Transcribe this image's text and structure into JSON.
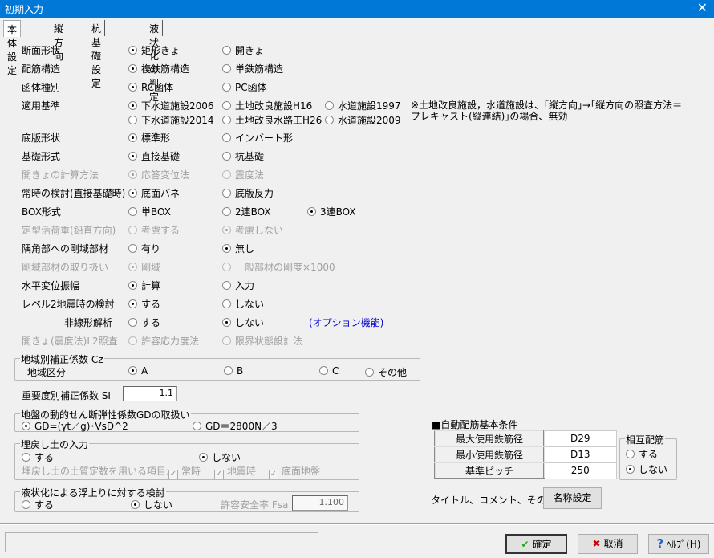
{
  "window": {
    "title": "初期入力",
    "close_label": "✕"
  },
  "tabs": [
    {
      "label": "本体設定",
      "active": true
    },
    {
      "label": "縦方向"
    },
    {
      "label": "杭基礎設定"
    },
    {
      "label": "液状化の判定"
    }
  ],
  "rows": [
    {
      "label": "断面形状",
      "options": [
        {
          "text": "矩形きょ",
          "checked": true
        },
        {
          "text": "開きょ"
        }
      ]
    },
    {
      "label": "配筋構造",
      "options": [
        {
          "text": "複鉄筋構造",
          "checked": true
        },
        {
          "text": "単鉄筋構造"
        }
      ]
    },
    {
      "label": "函体種別",
      "options": [
        {
          "text": "RC函体",
          "checked": true
        },
        {
          "text": "PC函体"
        }
      ]
    },
    {
      "label": "適用基準",
      "options": [
        {
          "text": "下水道施設2006",
          "checked": true
        },
        {
          "text": "土地改良施設H16"
        },
        {
          "text": "水道施設1997"
        }
      ],
      "options2": [
        {
          "text": "下水道施設2014"
        },
        {
          "text": "土地改良水路工H26"
        },
        {
          "text": "水道施設2009"
        }
      ]
    },
    {
      "label": "底版形状",
      "options": [
        {
          "text": "標準形",
          "checked": true
        },
        {
          "text": "インバート形"
        }
      ]
    },
    {
      "label": "基礎形式",
      "options": [
        {
          "text": "直接基礎",
          "checked": true
        },
        {
          "text": "杭基礎"
        }
      ]
    },
    {
      "label": "開きょの計算方法",
      "disabled": true,
      "options": [
        {
          "text": "応答変位法",
          "checked": true
        },
        {
          "text": "震度法"
        }
      ]
    },
    {
      "label": "常時の検討(直接基礎時)",
      "options": [
        {
          "text": "底面バネ",
          "checked": true
        },
        {
          "text": "底版反力"
        }
      ]
    },
    {
      "label": "BOX形式",
      "options": [
        {
          "text": "単BOX"
        },
        {
          "text": "2連BOX"
        },
        {
          "text": "3連BOX",
          "checked": true
        }
      ]
    },
    {
      "label": "定型活荷重(鉛直方向)",
      "disabled": true,
      "options": [
        {
          "text": "考慮する"
        },
        {
          "text": "考慮しない",
          "checked": true
        }
      ]
    },
    {
      "label": "隅角部への剛域部材",
      "options": [
        {
          "text": "有り"
        },
        {
          "text": "無し",
          "checked": true
        }
      ]
    },
    {
      "label": "剛域部材の取り扱い",
      "disabled": true,
      "options": [
        {
          "text": "剛域",
          "checked": true
        },
        {
          "text": "一般部材の剛度×1000"
        }
      ]
    },
    {
      "label": "水平変位振幅",
      "options": [
        {
          "text": "計算",
          "checked": true
        },
        {
          "text": "入力"
        }
      ]
    },
    {
      "label": "レベル2地震時の検討",
      "options": [
        {
          "text": "する",
          "checked": true
        },
        {
          "text": "しない"
        }
      ]
    },
    {
      "label": "非線形解析",
      "indent": true,
      "options": [
        {
          "text": "する"
        },
        {
          "text": "しない",
          "checked": true
        }
      ],
      "note": "(オプション機能)"
    },
    {
      "label": "開きょ(震度法)L2照査",
      "disabled": true,
      "options": [
        {
          "text": "許容応力度法"
        },
        {
          "text": "限界状態設計法"
        }
      ]
    }
  ],
  "standard_note": [
    "※土地改良施設，水道施設は、｢縦方向｣→｢縦方向の照査方法＝",
    "プレキャスト(縦連結)｣の場合、無効"
  ],
  "cz": {
    "legend": "地域別補正係数 Cz",
    "label": "地域区分",
    "options": [
      "A",
      "B",
      "C",
      "その他"
    ],
    "selected": 0
  },
  "si": {
    "label": "重要度別補正係数 SI",
    "value": "1.1"
  },
  "gd": {
    "legend": "地盤の動的せん断弾性係数GDの取扱い",
    "options": [
      "GD=(γt／g)･VsD^2",
      "GD＝2800N／3"
    ],
    "selected": 0
  },
  "backfill": {
    "legend": "埋戻し土の入力",
    "options": [
      "する",
      "しない"
    ],
    "selected": 1,
    "items_label": "埋戻し土の土質定数を用いる項目:",
    "items": [
      "常時",
      "地震時",
      "底面地盤"
    ]
  },
  "liq": {
    "legend": "液状化による浮上りに対する検討",
    "options": [
      "する",
      "しない"
    ],
    "selected": 1,
    "fsa_label": "許容安全率 Fsa",
    "fsa_value": "1.100"
  },
  "auto": {
    "title": "■自動配筋基本条件",
    "rows": [
      {
        "label": "最大使用鉄筋径",
        "value": "D29"
      },
      {
        "label": "最小使用鉄筋径",
        "value": "D13"
      },
      {
        "label": "基準ピッチ",
        "value": "250"
      }
    ]
  },
  "mutual": {
    "legend": "相互配筋",
    "options": [
      "する",
      "しない"
    ],
    "selected": 1
  },
  "naming": {
    "label": "タイトル、コメント、その他:",
    "button": "名称設定"
  },
  "buttons": {
    "ok": "確定",
    "cancel": "取消",
    "help": "ﾍﾙﾌﾟ(H)"
  },
  "colors": {
    "titlebar": "#0078d7",
    "note": "#0000cc"
  }
}
